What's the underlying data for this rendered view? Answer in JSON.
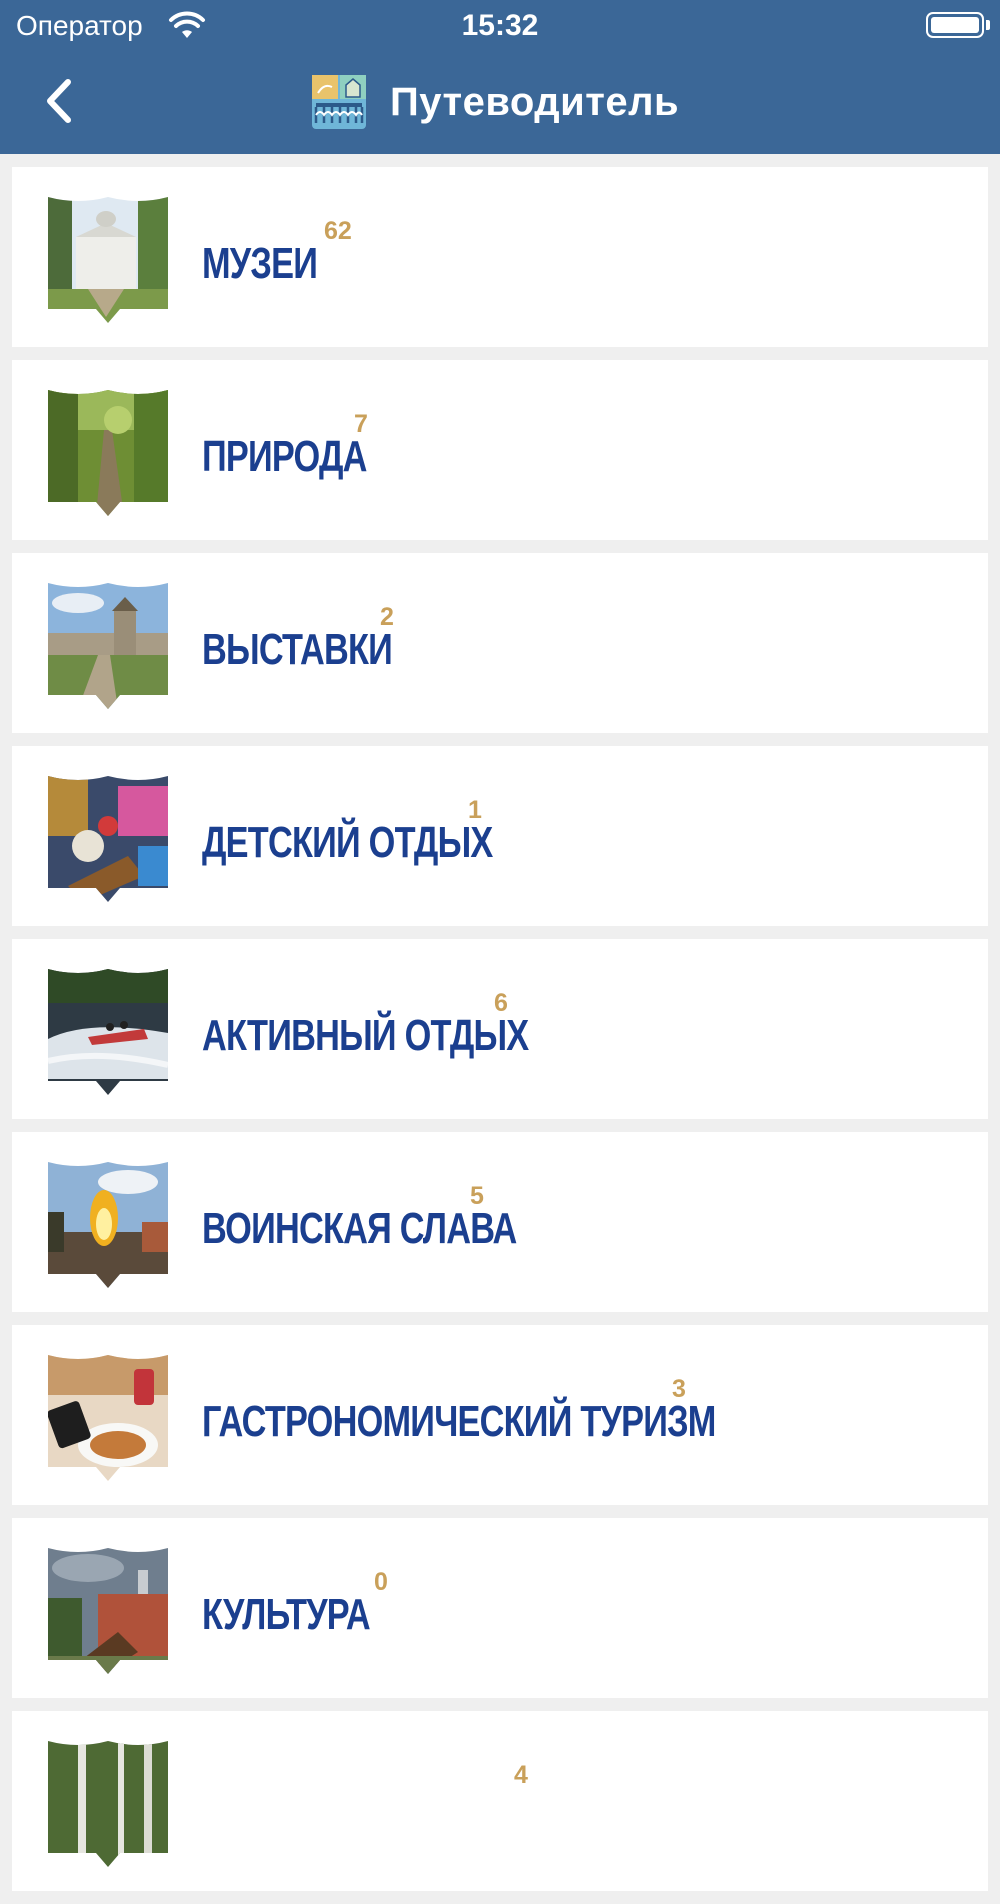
{
  "status_bar": {
    "carrier": "Оператор",
    "time": "15:32"
  },
  "nav": {
    "title": "Путеводитель",
    "back_icon": "chevron-left-icon",
    "logo_icon": "city-emblem-icon"
  },
  "colors": {
    "header_bg": "#3b6797",
    "title_text": "#1b3f8f",
    "count_text": "#c9a05a",
    "page_bg": "#efefef"
  },
  "categories": [
    {
      "title": "музеи",
      "count": "62",
      "thumb": "manor-house-photo"
    },
    {
      "title": "природа",
      "count": "7",
      "thumb": "forest-path-photo"
    },
    {
      "title": "выставки",
      "count": "2",
      "thumb": "fortress-wall-photo"
    },
    {
      "title": "детский отдых",
      "count": "1",
      "thumb": "carousel-toys-photo"
    },
    {
      "title": "активный отдых",
      "count": "6",
      "thumb": "jet-boat-river-photo"
    },
    {
      "title": "воинская слава",
      "count": "5",
      "thumb": "memorial-flame-photo"
    },
    {
      "title": "гастрономический туризм",
      "count": "3",
      "thumb": "food-table-photo"
    },
    {
      "title": "культура",
      "count": "0",
      "thumb": "brick-church-photo"
    },
    {
      "title": "",
      "count": "4",
      "thumb": "birch-forest-photo"
    }
  ]
}
